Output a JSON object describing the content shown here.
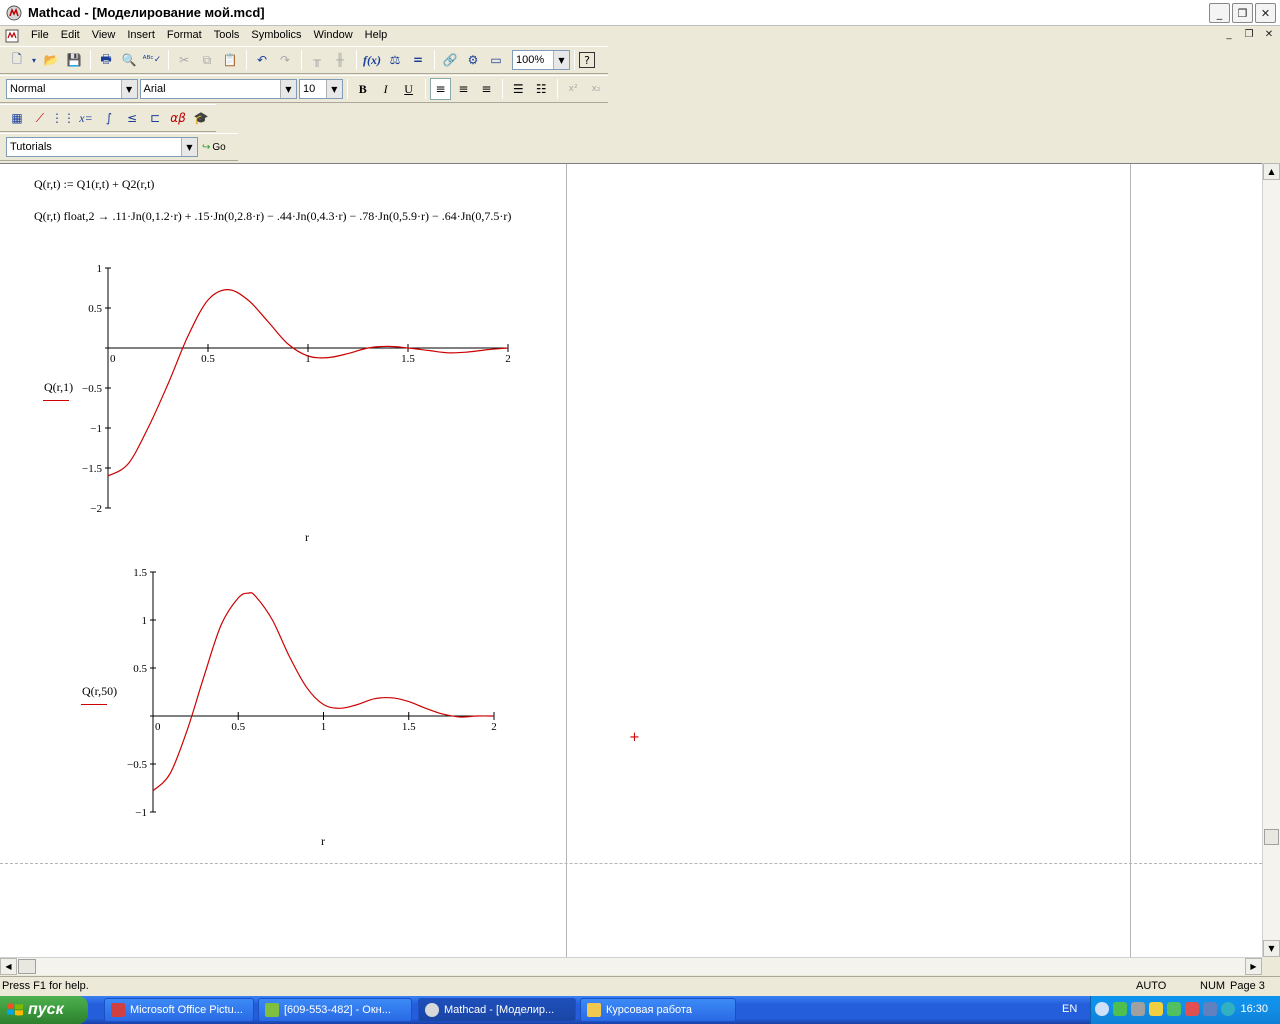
{
  "window": {
    "title": "Mathcad - [Моделирование мой.mcd]",
    "minimize": "_",
    "restore": "❐",
    "close": "✕"
  },
  "menu": {
    "items": [
      "File",
      "Edit",
      "View",
      "Insert",
      "Format",
      "Tools",
      "Symbolics",
      "Window",
      "Help"
    ]
  },
  "toolbar_standard": {
    "zoom": "100%"
  },
  "toolbar_formatting": {
    "style": "Normal",
    "font": "Arial",
    "size": "10",
    "bold": "B",
    "italic": "I",
    "underline": "U",
    "superscript": "x²",
    "subscript": "x₂"
  },
  "toolbar_resources": {
    "resource": "Tutorials",
    "go": "Go"
  },
  "document": {
    "definition": "Q(r,t) := Q1(r,t) + Q2(r,t)",
    "evaluation": "Q(r,t) float,2  → .11·Jn(0,1.2·r) + .15·Jn(0,2.8·r) − .44·Jn(0,4.3·r) − .78·Jn(0,5.9·r) − .64·Jn(0,7.5·r)"
  },
  "chart_data": [
    {
      "type": "line",
      "ylabel": "Q(r,1)",
      "xlabel": "r",
      "xlim": [
        0,
        2
      ],
      "ylim": [
        -2,
        1
      ],
      "xticks": [
        "0",
        "0.5",
        "1",
        "1.5",
        "2"
      ],
      "yticks": [
        "1",
        "0.5",
        "0",
        "−0.5",
        "−1",
        "−1.5",
        "−2"
      ],
      "line_color": "#cc0000",
      "x": [
        0,
        0.1,
        0.2,
        0.3,
        0.4,
        0.5,
        0.6,
        0.7,
        0.8,
        0.9,
        1.0,
        1.1,
        1.2,
        1.3,
        1.4,
        1.5,
        1.6,
        1.7,
        1.8,
        1.9,
        2.0
      ],
      "y": [
        -1.6,
        -1.45,
        -1.0,
        -0.45,
        0.15,
        0.6,
        0.73,
        0.6,
        0.33,
        0.05,
        -0.1,
        -0.12,
        -0.07,
        0.0,
        0.02,
        0.0,
        -0.03,
        -0.06,
        -0.05,
        -0.02,
        0.0
      ]
    },
    {
      "type": "line",
      "ylabel": "Q(r,50)",
      "xlabel": "r",
      "xlim": [
        0,
        2
      ],
      "ylim": [
        -1,
        1.5
      ],
      "xticks": [
        "0",
        "0.5",
        "1",
        "1.5",
        "2"
      ],
      "yticks": [
        "1.5",
        "1",
        "0.5",
        "0",
        "−0.5",
        "−1"
      ],
      "line_color": "#cc0000",
      "x": [
        0,
        0.1,
        0.2,
        0.3,
        0.4,
        0.5,
        0.56,
        0.6,
        0.7,
        0.8,
        0.9,
        1.0,
        1.1,
        1.2,
        1.3,
        1.4,
        1.5,
        1.6,
        1.7,
        1.8,
        1.9,
        2.0
      ],
      "y": [
        -0.78,
        -0.6,
        -0.15,
        0.42,
        0.95,
        1.23,
        1.28,
        1.25,
        1.0,
        0.62,
        0.3,
        0.12,
        0.08,
        0.12,
        0.18,
        0.19,
        0.15,
        0.08,
        0.02,
        -0.01,
        0.0,
        0.0
      ]
    }
  ],
  "status": {
    "help": "Press F1 for help.",
    "mode": "AUTO",
    "num": "NUM",
    "page": "Page 3"
  },
  "taskbar": {
    "start": "пуск",
    "tasks": [
      "Microsoft Office Pictu...",
      "[609-553-482] - Окн...",
      "Mathcad - [Моделир...",
      "Курсовая работа"
    ],
    "lang": "EN",
    "clock": "16:30"
  },
  "icons": {
    "new": "new-document-icon",
    "open": "open-folder-icon",
    "save": "save-icon",
    "print": "print-icon",
    "preview": "print-preview-icon",
    "spell": "spell-check-icon",
    "cut": "cut-icon",
    "copy": "copy-icon",
    "paste": "paste-icon",
    "undo": "undo-icon",
    "redo": "redo-icon",
    "help": "help-icon"
  }
}
